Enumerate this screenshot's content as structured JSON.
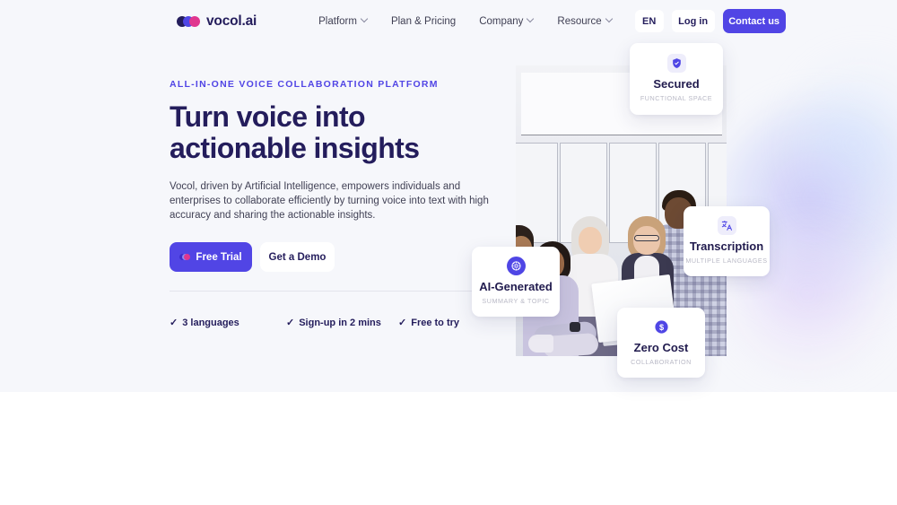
{
  "brand": {
    "name": "vocol.ai",
    "mark_icon": "vocol-logo-icon"
  },
  "nav": {
    "items": [
      {
        "label": "Platform",
        "has_chevron": true
      },
      {
        "label": "Plan & Pricing",
        "has_chevron": false
      },
      {
        "label": "Company",
        "has_chevron": true
      },
      {
        "label": "Resource",
        "has_chevron": true
      }
    ],
    "language": "EN",
    "login": "Log in",
    "contact": "Contact us"
  },
  "hero": {
    "eyebrow": "ALL-IN-ONE VOICE COLLABORATION PLATFORM",
    "headline_line1": "Turn voice into",
    "headline_line2": "actionable insights",
    "paragraph": "Vocol, driven by Artificial Intelligence, empowers individuals and enterprises to collaborate efficiently by turning voice into text with high accuracy and sharing the actionable insights.",
    "cta_primary": "Free Trial",
    "cta_secondary": "Get a Demo",
    "features": [
      {
        "tick": "✓",
        "label": "3 languages"
      },
      {
        "tick": "✓",
        "label": "Sign-up in 2 mins"
      },
      {
        "tick": "✓",
        "label": "Free to try"
      }
    ]
  },
  "cards": [
    {
      "icon": "shield-check-icon",
      "title": "Secured",
      "subtitle": "FUNCTIONAL SPACE"
    },
    {
      "icon": "translate-icon",
      "title": "Transcription",
      "subtitle": "MULTIPLE LANGUAGES"
    },
    {
      "icon": "ai-atom-icon",
      "title": "AI-Generated",
      "subtitle": "SUMMARY & TOPIC"
    },
    {
      "icon": "dollar-circle-icon",
      "title": "Zero Cost",
      "subtitle": "COLLABORATION"
    }
  ],
  "colors": {
    "accent": "#5145e5",
    "headline": "#241d5c",
    "hero_background": "#f6f7fb",
    "page_background": "#ffffff",
    "card_subtitle": "#b9b9c6",
    "logo_pink": "#e0368f"
  }
}
